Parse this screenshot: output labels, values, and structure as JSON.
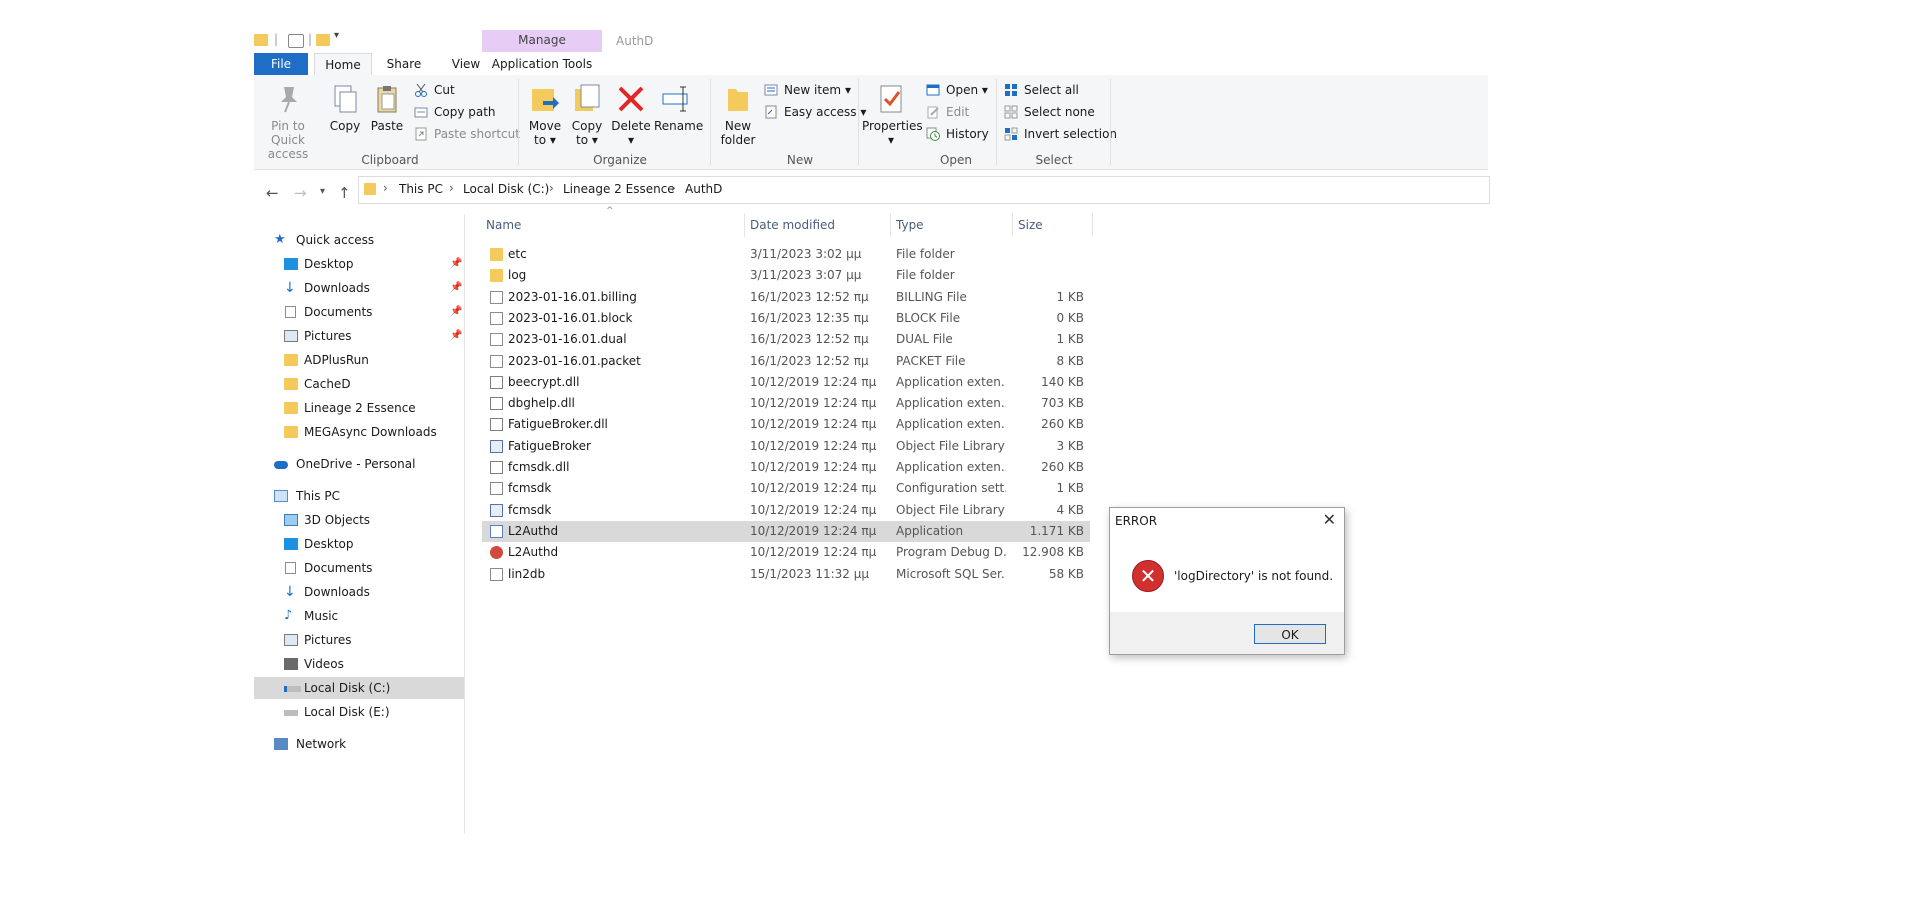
{
  "window": {
    "title": "AuthD",
    "manage_tab": "Manage"
  },
  "ribbon_tabs": [
    "File",
    "Home",
    "Share",
    "View",
    "Application Tools"
  ],
  "ribbon": {
    "clipboard": {
      "label": "Clipboard",
      "pin": "Pin to Quick access",
      "pin_l1": "Pin to Quick",
      "pin_l2": "access",
      "copy": "Copy",
      "paste": "Paste",
      "cut": "Cut",
      "copy_path": "Copy path",
      "paste_shortcut": "Paste shortcut"
    },
    "organize": {
      "label": "Organize",
      "move_l1": "Move",
      "move_l2": "to",
      "copy_l1": "Copy",
      "copy_l2": "to",
      "delete": "Delete",
      "rename": "Rename"
    },
    "new": {
      "label": "New",
      "folder_l1": "New",
      "folder_l2": "folder",
      "new_item": "New item",
      "easy_access": "Easy access"
    },
    "open": {
      "label": "Open",
      "properties": "Properties",
      "open": "Open",
      "edit": "Edit",
      "history": "History"
    },
    "select": {
      "label": "Select",
      "select_all": "Select all",
      "select_none": "Select none",
      "invert": "Invert selection"
    }
  },
  "breadcrumb": [
    "This PC",
    "Local Disk (C:)",
    "Lineage 2 Essence",
    "AuthD"
  ],
  "nav": {
    "quick_access": "Quick access",
    "pinned": [
      "Desktop",
      "Downloads",
      "Documents",
      "Pictures"
    ],
    "recent": [
      "ADPlusRun",
      "CacheD",
      "Lineage 2 Essence",
      "MEGAsync Downloads"
    ],
    "onedrive": "OneDrive - Personal",
    "this_pc": "This PC",
    "pc_items": [
      "3D Objects",
      "Desktop",
      "Documents",
      "Downloads",
      "Music",
      "Pictures",
      "Videos",
      "Local Disk (C:)",
      "Local Disk (E:)"
    ],
    "network": "Network"
  },
  "columns": {
    "name": "Name",
    "date": "Date modified",
    "type": "Type",
    "size": "Size"
  },
  "files": [
    {
      "name": "etc",
      "date": "3/11/2023 3:02 μμ",
      "type": "File folder",
      "size": "",
      "icon": "folder"
    },
    {
      "name": "log",
      "date": "3/11/2023 3:07 μμ",
      "type": "File folder",
      "size": "",
      "icon": "folder"
    },
    {
      "name": "2023-01-16.01.billing",
      "date": "16/1/2023 12:52 πμ",
      "type": "BILLING File",
      "size": "1 KB",
      "icon": "file"
    },
    {
      "name": "2023-01-16.01.block",
      "date": "16/1/2023 12:35 πμ",
      "type": "BLOCK File",
      "size": "0 KB",
      "icon": "file"
    },
    {
      "name": "2023-01-16.01.dual",
      "date": "16/1/2023 12:52 πμ",
      "type": "DUAL File",
      "size": "1 KB",
      "icon": "file"
    },
    {
      "name": "2023-01-16.01.packet",
      "date": "16/1/2023 12:52 πμ",
      "type": "PACKET File",
      "size": "8 KB",
      "icon": "file"
    },
    {
      "name": "beecrypt.dll",
      "date": "10/12/2019 12:24 πμ",
      "type": "Application exten...",
      "size": "140 KB",
      "icon": "dll"
    },
    {
      "name": "dbghelp.dll",
      "date": "10/12/2019 12:24 πμ",
      "type": "Application exten...",
      "size": "703 KB",
      "icon": "dll"
    },
    {
      "name": "FatigueBroker.dll",
      "date": "10/12/2019 12:24 πμ",
      "type": "Application exten...",
      "size": "260 KB",
      "icon": "dll"
    },
    {
      "name": "FatigueBroker",
      "date": "10/12/2019 12:24 πμ",
      "type": "Object File Library",
      "size": "3 KB",
      "icon": "obj"
    },
    {
      "name": "fcmsdk.dll",
      "date": "10/12/2019 12:24 πμ",
      "type": "Application exten...",
      "size": "260 KB",
      "icon": "dll"
    },
    {
      "name": "fcmsdk",
      "date": "10/12/2019 12:24 πμ",
      "type": "Configuration sett...",
      "size": "1 KB",
      "icon": "cfg"
    },
    {
      "name": "fcmsdk",
      "date": "10/12/2019 12:24 πμ",
      "type": "Object File Library",
      "size": "4 KB",
      "icon": "obj"
    },
    {
      "name": "L2Authd",
      "date": "10/12/2019 12:24 πμ",
      "type": "Application",
      "size": "1.171 KB",
      "icon": "app",
      "selected": true
    },
    {
      "name": "L2Authd",
      "date": "10/12/2019 12:24 πμ",
      "type": "Program Debug D...",
      "size": "12.908 KB",
      "icon": "dbg"
    },
    {
      "name": "lin2db",
      "date": "15/1/2023 11:32 μμ",
      "type": "Microsoft SQL Ser...",
      "size": "58 KB",
      "icon": "sql"
    }
  ],
  "dialog": {
    "title": "ERROR",
    "message": "'logDirectory' is not found.",
    "ok": "OK"
  },
  "colors": {
    "accent": "#1e6ec8",
    "manage_tab": "#e7cdf5",
    "folder": "#f4ca5c",
    "error": "#d22f2f",
    "selection": "#d9d9d9"
  }
}
